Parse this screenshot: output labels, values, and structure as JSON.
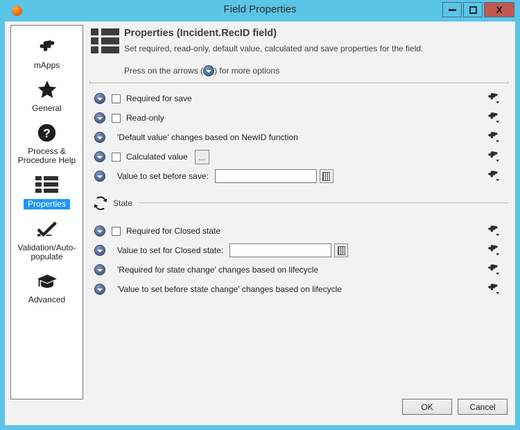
{
  "window": {
    "title": "Field Properties",
    "icon": "app-sphere-icon",
    "minimize_label": "Minimize",
    "maximize_label": "Maximize",
    "close_label": "X",
    "titlebar_color": "#5bc5e8",
    "close_button_color": "#c3584f"
  },
  "sidebar": {
    "items": [
      {
        "label": "mApps",
        "icon": "puzzle-icon",
        "active": false
      },
      {
        "label": "General",
        "icon": "star-icon",
        "active": false
      },
      {
        "label": "Process & Procedure Help",
        "icon": "question-mark-icon",
        "active": false
      },
      {
        "label": "Properties",
        "icon": "list-grid-icon",
        "active": true
      },
      {
        "label": "Validation/Auto-populate",
        "icon": "checkmark-icon",
        "active": false
      },
      {
        "label": "Advanced",
        "icon": "graduation-cap-icon",
        "active": false
      }
    ],
    "active_highlight_color": "#2196f3"
  },
  "header": {
    "icon": "list-grid-icon",
    "title": "Properties (Incident.RecID field)",
    "subtitle": "Set required, read-only, default value, calculated and save properties for the field.",
    "hint_prefix": "Press on the arrows (",
    "hint_suffix": ") for more options"
  },
  "main_rows": [
    {
      "type": "checkbox",
      "arrow": "dropdown-arrow-icon",
      "checked": false,
      "label": "Required for save",
      "puzzle": "puzzle-menu-icon"
    },
    {
      "type": "checkbox",
      "arrow": "dropdown-arrow-icon",
      "checked": false,
      "label": "Read-only",
      "puzzle": "puzzle-menu-icon"
    },
    {
      "type": "text",
      "arrow": "dropdown-arrow-icon",
      "label": "'Default value' changes based on NewID function",
      "puzzle": "puzzle-menu-icon"
    },
    {
      "type": "checkbox-button",
      "arrow": "dropdown-arrow-icon",
      "checked": false,
      "label": "Calculated value",
      "button_label": "...",
      "puzzle": "puzzle-menu-icon"
    },
    {
      "type": "input",
      "arrow": "dropdown-arrow-icon",
      "label": "Value to set before save:",
      "value": "",
      "placeholder": "",
      "input_width": 147,
      "picker_icon": "list-picker-icon",
      "puzzle": "puzzle-menu-icon"
    }
  ],
  "state_group": {
    "icon": "refresh-cycle-icon",
    "label": "State",
    "rows": [
      {
        "type": "checkbox",
        "arrow": "dropdown-arrow-icon",
        "checked": false,
        "label": "Required for Closed state",
        "puzzle": "puzzle-menu-icon"
      },
      {
        "type": "input",
        "arrow": "dropdown-arrow-icon",
        "label": "Value to set for Closed state:",
        "value": "",
        "placeholder": "",
        "input_width": 147,
        "picker_icon": "list-picker-icon",
        "puzzle": "puzzle-menu-icon"
      },
      {
        "type": "text",
        "arrow": "dropdown-arrow-icon",
        "label": "'Required for state change' changes based on lifecycle",
        "puzzle": "puzzle-menu-icon"
      },
      {
        "type": "text",
        "arrow": "dropdown-arrow-icon",
        "label": "'Value to set before state change' changes based on lifecycle",
        "puzzle": "puzzle-menu-icon"
      }
    ]
  },
  "footer": {
    "ok_label": "OK",
    "cancel_label": "Cancel"
  }
}
